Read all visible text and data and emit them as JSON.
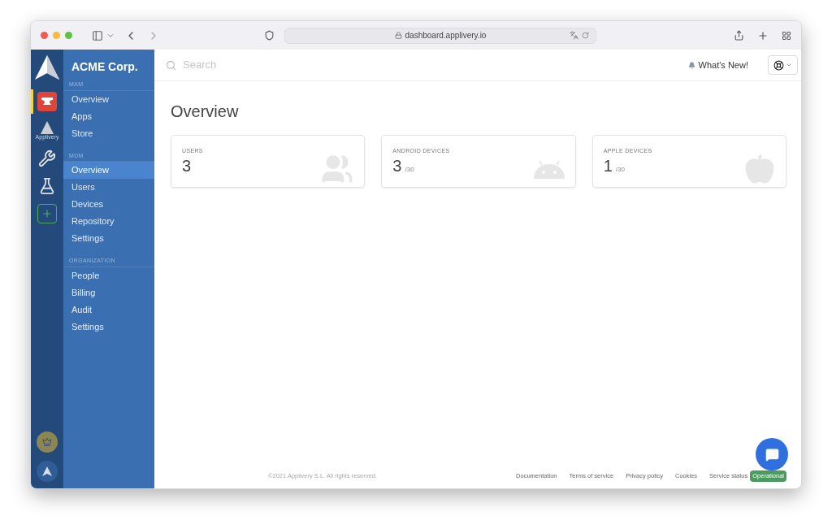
{
  "browser": {
    "url": "dashboard.applivery.io"
  },
  "rail": {
    "apps": [
      {
        "kind": "anvil",
        "selected": true
      },
      {
        "kind": "logo",
        "label": "Applivery",
        "selected": false
      },
      {
        "kind": "tools",
        "selected": false
      },
      {
        "kind": "lab",
        "selected": false
      }
    ]
  },
  "sidebar": {
    "org": "ACME Corp.",
    "sections": [
      {
        "title": "MAM",
        "items": [
          {
            "label": "Overview",
            "selected": false
          },
          {
            "label": "Apps",
            "selected": false
          },
          {
            "label": "Store",
            "selected": false
          }
        ]
      },
      {
        "title": "MDM",
        "items": [
          {
            "label": "Overview",
            "selected": true
          },
          {
            "label": "Users",
            "selected": false
          },
          {
            "label": "Devices",
            "selected": false
          },
          {
            "label": "Repository",
            "selected": false
          },
          {
            "label": "Settings",
            "selected": false
          }
        ]
      },
      {
        "title": "ORGANIZATION",
        "items": [
          {
            "label": "People",
            "selected": false
          },
          {
            "label": "Billing",
            "selected": false
          },
          {
            "label": "Audit",
            "selected": false
          },
          {
            "label": "Settings",
            "selected": false
          }
        ]
      }
    ]
  },
  "header": {
    "search": {
      "placeholder": "Search"
    },
    "whats_new": "What's New!"
  },
  "page": {
    "title": "Overview",
    "cards": [
      {
        "kind": "users",
        "label": "USERS",
        "value": "3"
      },
      {
        "kind": "android",
        "label": "ANDROID DEVICES",
        "value": "3",
        "limit": "/30"
      },
      {
        "kind": "apple",
        "label": "APPLE DEVICES",
        "value": "1",
        "limit": "/30"
      }
    ]
  },
  "footer": {
    "copyright": "©2021 Applivery S.L. All rights reserved.",
    "links": [
      "Documentation",
      "Terms of service",
      "Privacy policy",
      "Cookies"
    ],
    "status_label": "Service status",
    "status": "Operational"
  }
}
